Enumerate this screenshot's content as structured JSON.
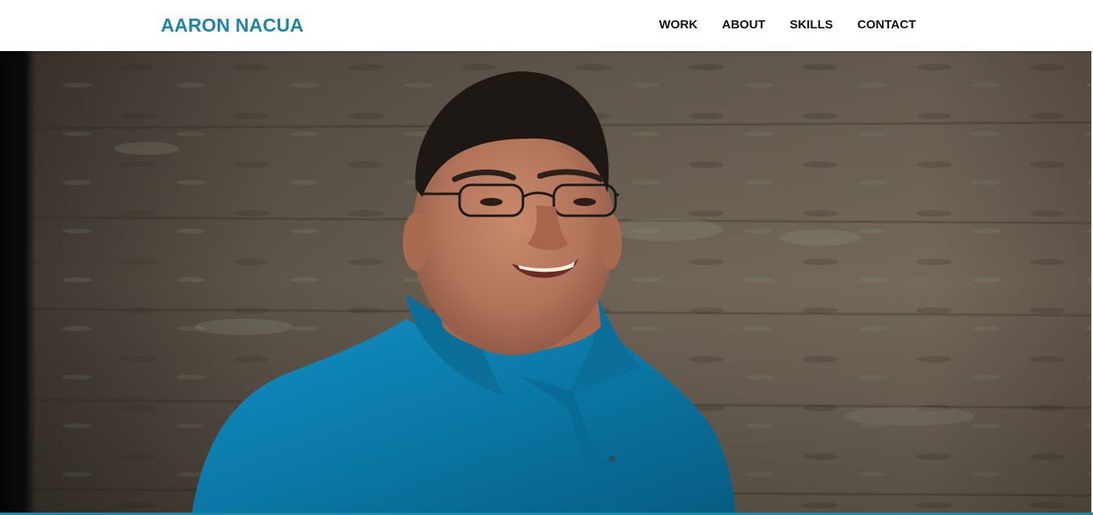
{
  "header": {
    "brand": "AARON NACUA",
    "nav": [
      {
        "label": "WORK"
      },
      {
        "label": "ABOUT"
      },
      {
        "label": "SKILLS"
      },
      {
        "label": "CONTACT"
      }
    ]
  },
  "hero": {
    "image": "portrait-photo"
  },
  "colors": {
    "brand": "#1a86a8",
    "nav_text": "#111111",
    "shirt": "#0a78a6",
    "wall": "#6b5f52"
  }
}
